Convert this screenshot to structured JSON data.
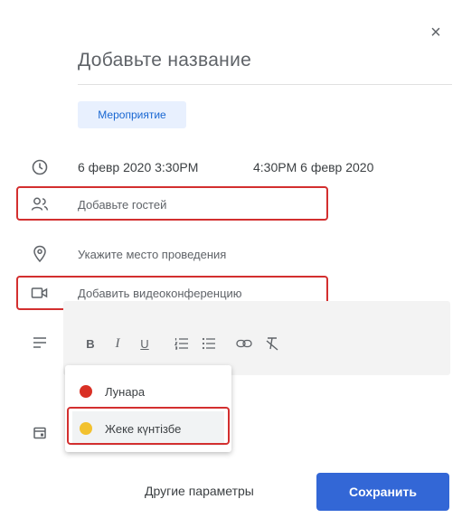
{
  "dialog": {
    "close_glyph": "×",
    "title_placeholder": "Добавьте название",
    "event_type": "Мероприятие"
  },
  "datetime": {
    "start": "6 февр 2020 3:30PM",
    "end": "4:30PM 6 февр 2020"
  },
  "guests_label": "Добавьте гостей",
  "location_label": "Укажите место проведения",
  "video_label": "Добавить видеоконференцию",
  "toolbar": {
    "bold": "B",
    "italic": "I",
    "underline": "U",
    "ordered_list_icon": "ordered-list-icon",
    "bulleted_list_icon": "bulleted-list-icon",
    "link_icon": "link-icon",
    "clear_format_icon": "clear-formatting-icon"
  },
  "calendars": [
    {
      "label": "Лунара",
      "color": "#d93025"
    },
    {
      "label": "Жеке күнтізбе",
      "color": "#f2c12e"
    }
  ],
  "footer": {
    "more_options": "Другие параметры",
    "save": "Сохранить"
  },
  "colors": {
    "accent": "#3367d6",
    "highlight": "#d32f2f",
    "chip_bg": "#e8f0fe"
  }
}
